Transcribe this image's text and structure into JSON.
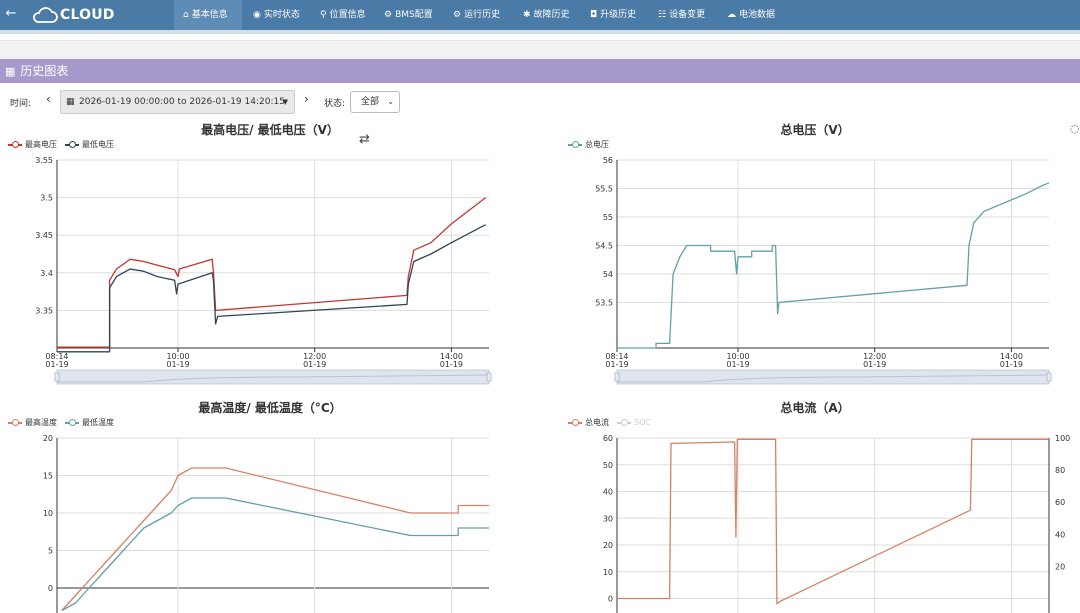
{
  "nav": {
    "back_icon": "back-arrow-icon",
    "logo_text": "CLOUD",
    "items": [
      {
        "label": "基本信息",
        "icon": "home-icon",
        "active": true
      },
      {
        "label": "实时状态",
        "icon": "eye-icon",
        "active": false
      },
      {
        "label": "位置信息",
        "icon": "map-marker-icon",
        "active": false
      },
      {
        "label": "BMS配置",
        "icon": "gear-icon",
        "active": false
      },
      {
        "label": "运行历史",
        "icon": "gears-icon",
        "active": false
      },
      {
        "label": "故障历史",
        "icon": "bug-icon",
        "active": false
      },
      {
        "label": "升级历史",
        "icon": "camera-icon",
        "active": false
      },
      {
        "label": "设备变更",
        "icon": "sitemap-icon",
        "active": false
      },
      {
        "label": "电池数据",
        "icon": "cloud-upload-icon",
        "active": false
      }
    ],
    "bar_color": "#4a7aa6"
  },
  "section": {
    "title": "历史图表",
    "icon": "table-icon",
    "color": "#a899cc"
  },
  "filter": {
    "time_label": "时间:",
    "date_range": "2026-01-19 00:00:00 to 2026-01-19 14:20:15",
    "status_label": "状态:",
    "status_value": "全部"
  },
  "charts": {
    "voltage_minmax": {
      "title": "最高电压/ 最低电压（V）",
      "legend": [
        "最高电压",
        "最低电压"
      ]
    },
    "total_voltage": {
      "title": "总电压（V）",
      "legend": [
        "总电压"
      ]
    },
    "temperature": {
      "title": "最高温度/ 最低温度（°C）",
      "legend": [
        "最高温度",
        "最低温度"
      ]
    },
    "current": {
      "title": "总电流（A）",
      "legend": [
        "总电流",
        "SOC"
      ]
    }
  },
  "chart_data": [
    {
      "type": "line",
      "title": "最高电压/ 最低电压（V）",
      "x_ticks": [
        "08:14\n01-19",
        "10:00\n01-19",
        "12:00\n01-19",
        "14:00\n01-19"
      ],
      "ylim": [
        3.3,
        3.55
      ],
      "y_ticks": [
        3.3,
        3.35,
        3.4,
        3.45,
        3.5,
        3.55
      ],
      "grid": true,
      "series": [
        {
          "name": "最高电压",
          "color": "#c23531",
          "points": [
            [
              8.23,
              3.301
            ],
            [
              9.0,
              3.301
            ],
            [
              9.0,
              3.39
            ],
            [
              9.1,
              3.405
            ],
            [
              9.3,
              3.418
            ],
            [
              9.5,
              3.415
            ],
            [
              9.7,
              3.41
            ],
            [
              9.95,
              3.404
            ],
            [
              10.0,
              3.395
            ],
            [
              10.02,
              3.405
            ],
            [
              10.5,
              3.418
            ],
            [
              10.52,
              3.4
            ],
            [
              10.55,
              3.35
            ],
            [
              13.35,
              3.37
            ],
            [
              13.37,
              3.395
            ],
            [
              13.45,
              3.43
            ],
            [
              13.7,
              3.44
            ],
            [
              14.0,
              3.465
            ],
            [
              14.5,
              3.5
            ]
          ]
        },
        {
          "name": "最低电压",
          "color": "#2f4554",
          "points": [
            [
              8.23,
              3.295
            ],
            [
              9.0,
              3.295
            ],
            [
              9.0,
              3.38
            ],
            [
              9.1,
              3.395
            ],
            [
              9.3,
              3.405
            ],
            [
              9.5,
              3.402
            ],
            [
              9.7,
              3.395
            ],
            [
              9.95,
              3.39
            ],
            [
              9.98,
              3.372
            ],
            [
              10.0,
              3.385
            ],
            [
              10.5,
              3.4
            ],
            [
              10.52,
              3.39
            ],
            [
              10.55,
              3.332
            ],
            [
              10.58,
              3.342
            ],
            [
              13.35,
              3.358
            ],
            [
              13.37,
              3.385
            ],
            [
              13.45,
              3.415
            ],
            [
              13.7,
              3.425
            ],
            [
              14.0,
              3.44
            ],
            [
              14.5,
              3.464
            ]
          ]
        }
      ]
    },
    {
      "type": "line",
      "title": "总电压（V）",
      "x_ticks": [
        "08:14\n01-19",
        "10:00\n01-19",
        "12:00\n01-19",
        "14:00\n01-19"
      ],
      "ylim": [
        52.7,
        56
      ],
      "y_ticks": [
        52.7,
        53,
        53.5,
        54,
        54.5,
        55,
        55.5,
        56
      ],
      "grid": true,
      "series": [
        {
          "name": "总电压",
          "color": "#61a0a8",
          "points": [
            [
              8.23,
              52.7
            ],
            [
              8.8,
              52.7
            ],
            [
              8.8,
              52.78
            ],
            [
              8.92,
              52.78
            ],
            [
              9.0,
              52.78
            ],
            [
              9.05,
              54.0
            ],
            [
              9.15,
              54.3
            ],
            [
              9.25,
              54.5
            ],
            [
              9.6,
              54.5
            ],
            [
              9.6,
              54.4
            ],
            [
              9.95,
              54.4
            ],
            [
              9.98,
              54.0
            ],
            [
              10.0,
              54.3
            ],
            [
              10.2,
              54.3
            ],
            [
              10.2,
              54.4
            ],
            [
              10.5,
              54.4
            ],
            [
              10.5,
              54.5
            ],
            [
              10.55,
              54.5
            ],
            [
              10.58,
              53.3
            ],
            [
              10.6,
              53.5
            ],
            [
              13.35,
              53.8
            ],
            [
              13.38,
              54.5
            ],
            [
              13.45,
              54.9
            ],
            [
              13.6,
              55.1
            ],
            [
              14.0,
              55.3
            ],
            [
              14.2,
              55.4
            ],
            [
              14.45,
              55.55
            ],
            [
              14.55,
              55.6
            ]
          ]
        }
      ]
    },
    {
      "type": "line",
      "title": "最高温度/ 最低温度（°C）",
      "ylim": [
        0,
        20
      ],
      "y_ticks": [
        0,
        5,
        10,
        15,
        20
      ],
      "grid": true,
      "series": [
        {
          "name": "最高温度",
          "color": "#d48265",
          "points": [
            [
              8.3,
              -3
            ],
            [
              8.5,
              -1
            ],
            [
              8.7,
              1
            ],
            [
              8.9,
              3
            ],
            [
              9.1,
              5
            ],
            [
              9.3,
              7
            ],
            [
              9.5,
              9
            ],
            [
              9.7,
              11
            ],
            [
              9.9,
              13
            ],
            [
              10.0,
              15
            ],
            [
              10.2,
              16
            ],
            [
              10.7,
              16
            ],
            [
              13.4,
              10
            ],
            [
              14.1,
              10
            ],
            [
              14.1,
              11
            ],
            [
              14.55,
              11
            ]
          ]
        },
        {
          "name": "最低温度",
          "color": "#61a0a8",
          "points": [
            [
              8.3,
              -3
            ],
            [
              8.5,
              -2
            ],
            [
              8.7,
              0
            ],
            [
              8.9,
              2
            ],
            [
              9.1,
              4
            ],
            [
              9.3,
              6
            ],
            [
              9.5,
              8
            ],
            [
              9.7,
              9
            ],
            [
              9.9,
              10
            ],
            [
              10.0,
              11
            ],
            [
              10.2,
              12
            ],
            [
              10.7,
              12
            ],
            [
              13.4,
              7
            ],
            [
              14.1,
              7
            ],
            [
              14.1,
              8
            ],
            [
              14.55,
              8
            ]
          ]
        }
      ]
    },
    {
      "type": "line",
      "title": "总电流（A）",
      "ylim": [
        0,
        60
      ],
      "y_ticks": [
        0,
        10,
        20,
        30,
        40,
        50,
        60
      ],
      "y2_ticks": [
        20,
        40,
        60,
        80,
        100
      ],
      "grid": true,
      "series": [
        {
          "name": "总电流",
          "color": "#d48265",
          "points": [
            [
              8.23,
              0
            ],
            [
              9.0,
              0
            ],
            [
              9.02,
              58
            ],
            [
              9.95,
              58.5
            ],
            [
              9.97,
              23
            ],
            [
              9.99,
              59.5
            ],
            [
              10.55,
              59.5
            ],
            [
              10.57,
              -2
            ],
            [
              10.62,
              -1
            ],
            [
              13.4,
              33
            ],
            [
              13.42,
              59.5
            ],
            [
              14.55,
              59.5
            ]
          ]
        },
        {
          "name": "SOC",
          "color": "#cccccc",
          "points": []
        }
      ]
    }
  ]
}
